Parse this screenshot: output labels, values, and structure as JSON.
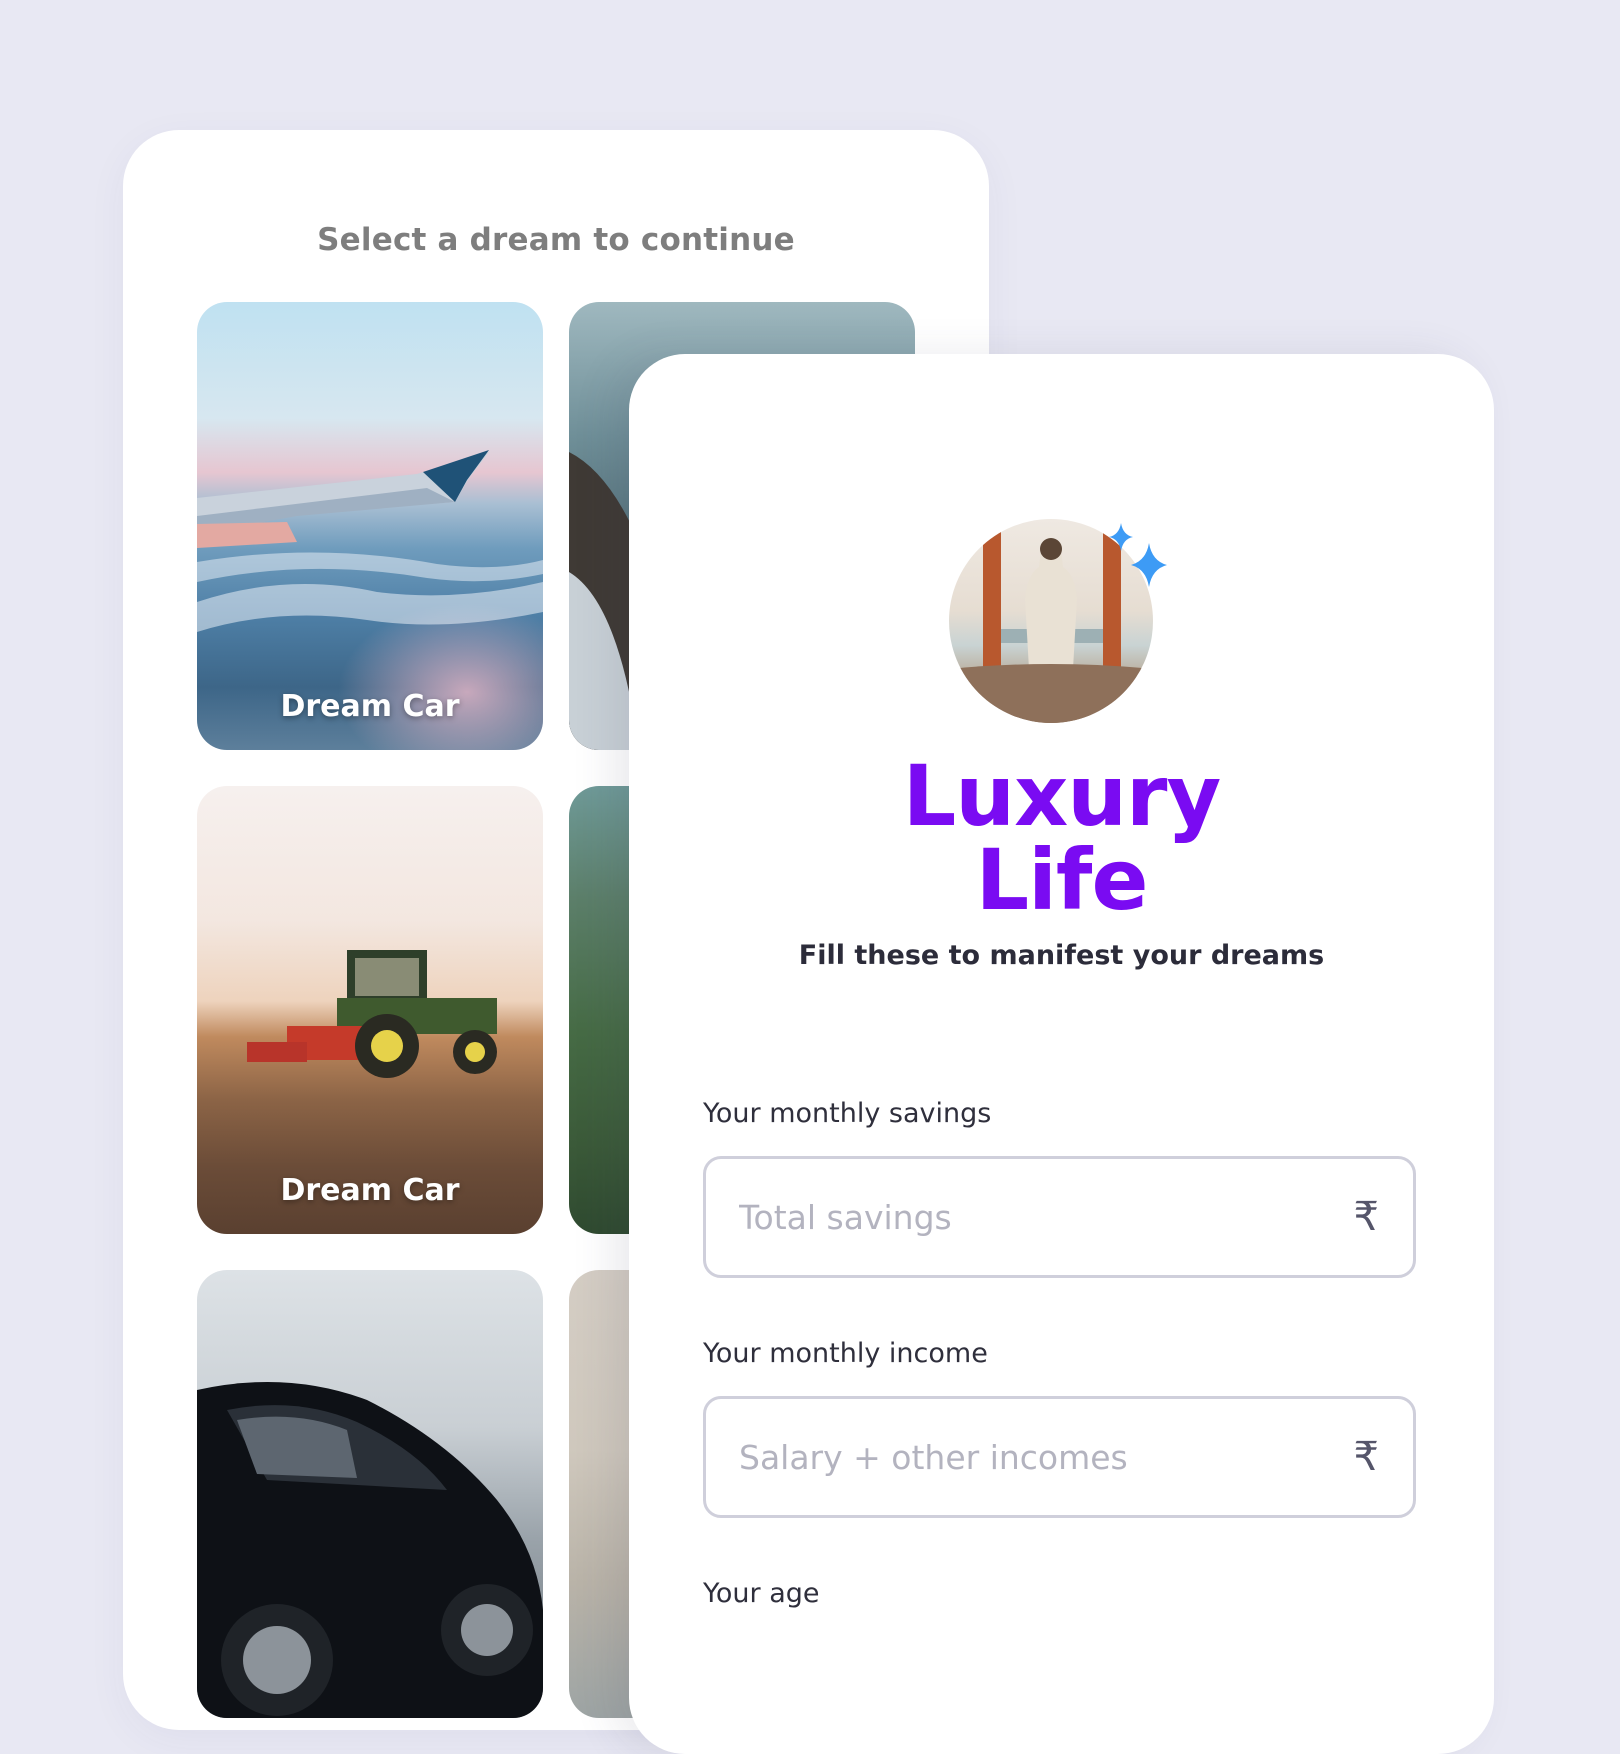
{
  "dream_picker": {
    "title": "Select a dream to continue",
    "tiles": [
      {
        "label": "Dream Car",
        "image": "airplane-wing-above-clouds"
      },
      {
        "label": "",
        "image": "person-by-sea"
      },
      {
        "label": "Dream Car",
        "image": "tractor-in-field"
      },
      {
        "label": "",
        "image": "green-hills"
      },
      {
        "label": "",
        "image": "black-sports-car"
      },
      {
        "label": "",
        "image": "beach"
      }
    ]
  },
  "dream_form": {
    "avatar_icon": "man-in-robe-at-window",
    "sparkle_icon": "sparkle-icon",
    "title_line1": "Luxury",
    "title_line2": "Life",
    "subtitle": "Fill these to manifest your dreams",
    "fields": [
      {
        "label": "Your monthly savings",
        "placeholder": "Total savings",
        "value": "",
        "currency_symbol": "₹"
      },
      {
        "label": "Your monthly income",
        "placeholder": "Salary + other incomes",
        "value": "",
        "currency_symbol": "₹"
      },
      {
        "label": "Your age",
        "placeholder": "",
        "value": "",
        "currency_symbol": ""
      }
    ]
  },
  "colors": {
    "background": "#e8e8f3",
    "accent": "#7a0bf2",
    "sparkle": "#3d9bf5",
    "card": "#ffffff"
  }
}
